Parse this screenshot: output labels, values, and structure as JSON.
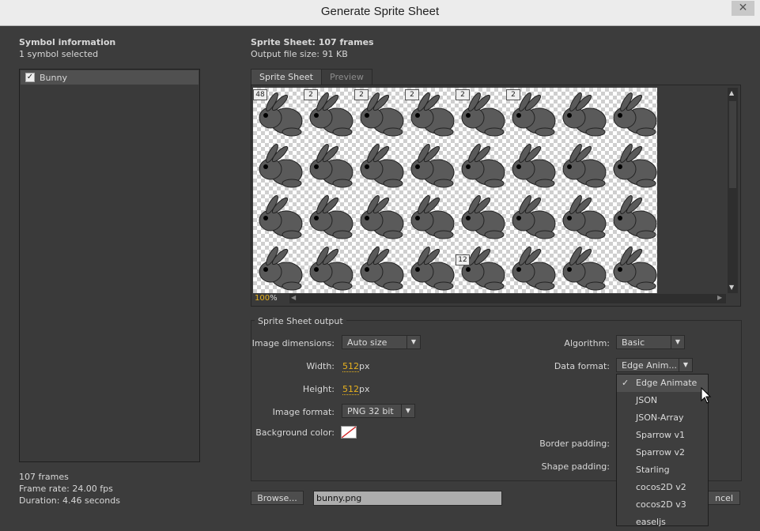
{
  "window": {
    "title": "Generate Sprite Sheet",
    "close": "✕"
  },
  "symbols": {
    "header": "Symbol information",
    "count": "1 symbol selected",
    "items": [
      {
        "name": "Bunny",
        "checked": true
      }
    ]
  },
  "stats": {
    "frames": "107 frames",
    "frame_rate": "Frame rate: 24.00 fps",
    "duration": "Duration: 4.46 seconds"
  },
  "sheet_info": {
    "title": "Sprite Sheet: 107 frames",
    "file_size": "Output file size: 91 KB"
  },
  "tabs": [
    {
      "label": "Sprite Sheet",
      "active": true
    },
    {
      "label": "Preview",
      "active": false
    }
  ],
  "viewer": {
    "zoom_value": "100",
    "zoom_unit": "%",
    "badges": [
      "48",
      "2",
      "2",
      "2",
      "2",
      "2",
      "12"
    ]
  },
  "output": {
    "legend": "Sprite Sheet output",
    "image_dimensions": {
      "label": "Image dimensions:",
      "value": "Auto size"
    },
    "width": {
      "label": "Width:",
      "value": "512",
      "unit": "px"
    },
    "height": {
      "label": "Height:",
      "value": "512",
      "unit": "px"
    },
    "image_format": {
      "label": "Image format:",
      "value": "PNG 32 bit"
    },
    "background_color": {
      "label": "Background color:"
    },
    "algorithm": {
      "label": "Algorithm:",
      "value": "Basic"
    },
    "data_format": {
      "label": "Data format:",
      "value": "Edge Anim..."
    },
    "border_padding": {
      "label": "Border padding:"
    },
    "shape_padding": {
      "label": "Shape padding:"
    }
  },
  "data_format_menu": {
    "items": [
      "Edge Animate",
      "JSON",
      "JSON-Array",
      "Sparrow v1",
      "Sparrow v2",
      "Starling",
      "cocos2D v2",
      "cocos2D v3",
      "easeljs"
    ],
    "selected": "Edge Animate"
  },
  "footer": {
    "browse": "Browse...",
    "filename": "bunny.png",
    "cancel_partial": "ncel"
  },
  "colors": {
    "accent_value": "#e8b21e",
    "bg": "#3c3c3c",
    "titlebar": "#ececec"
  }
}
